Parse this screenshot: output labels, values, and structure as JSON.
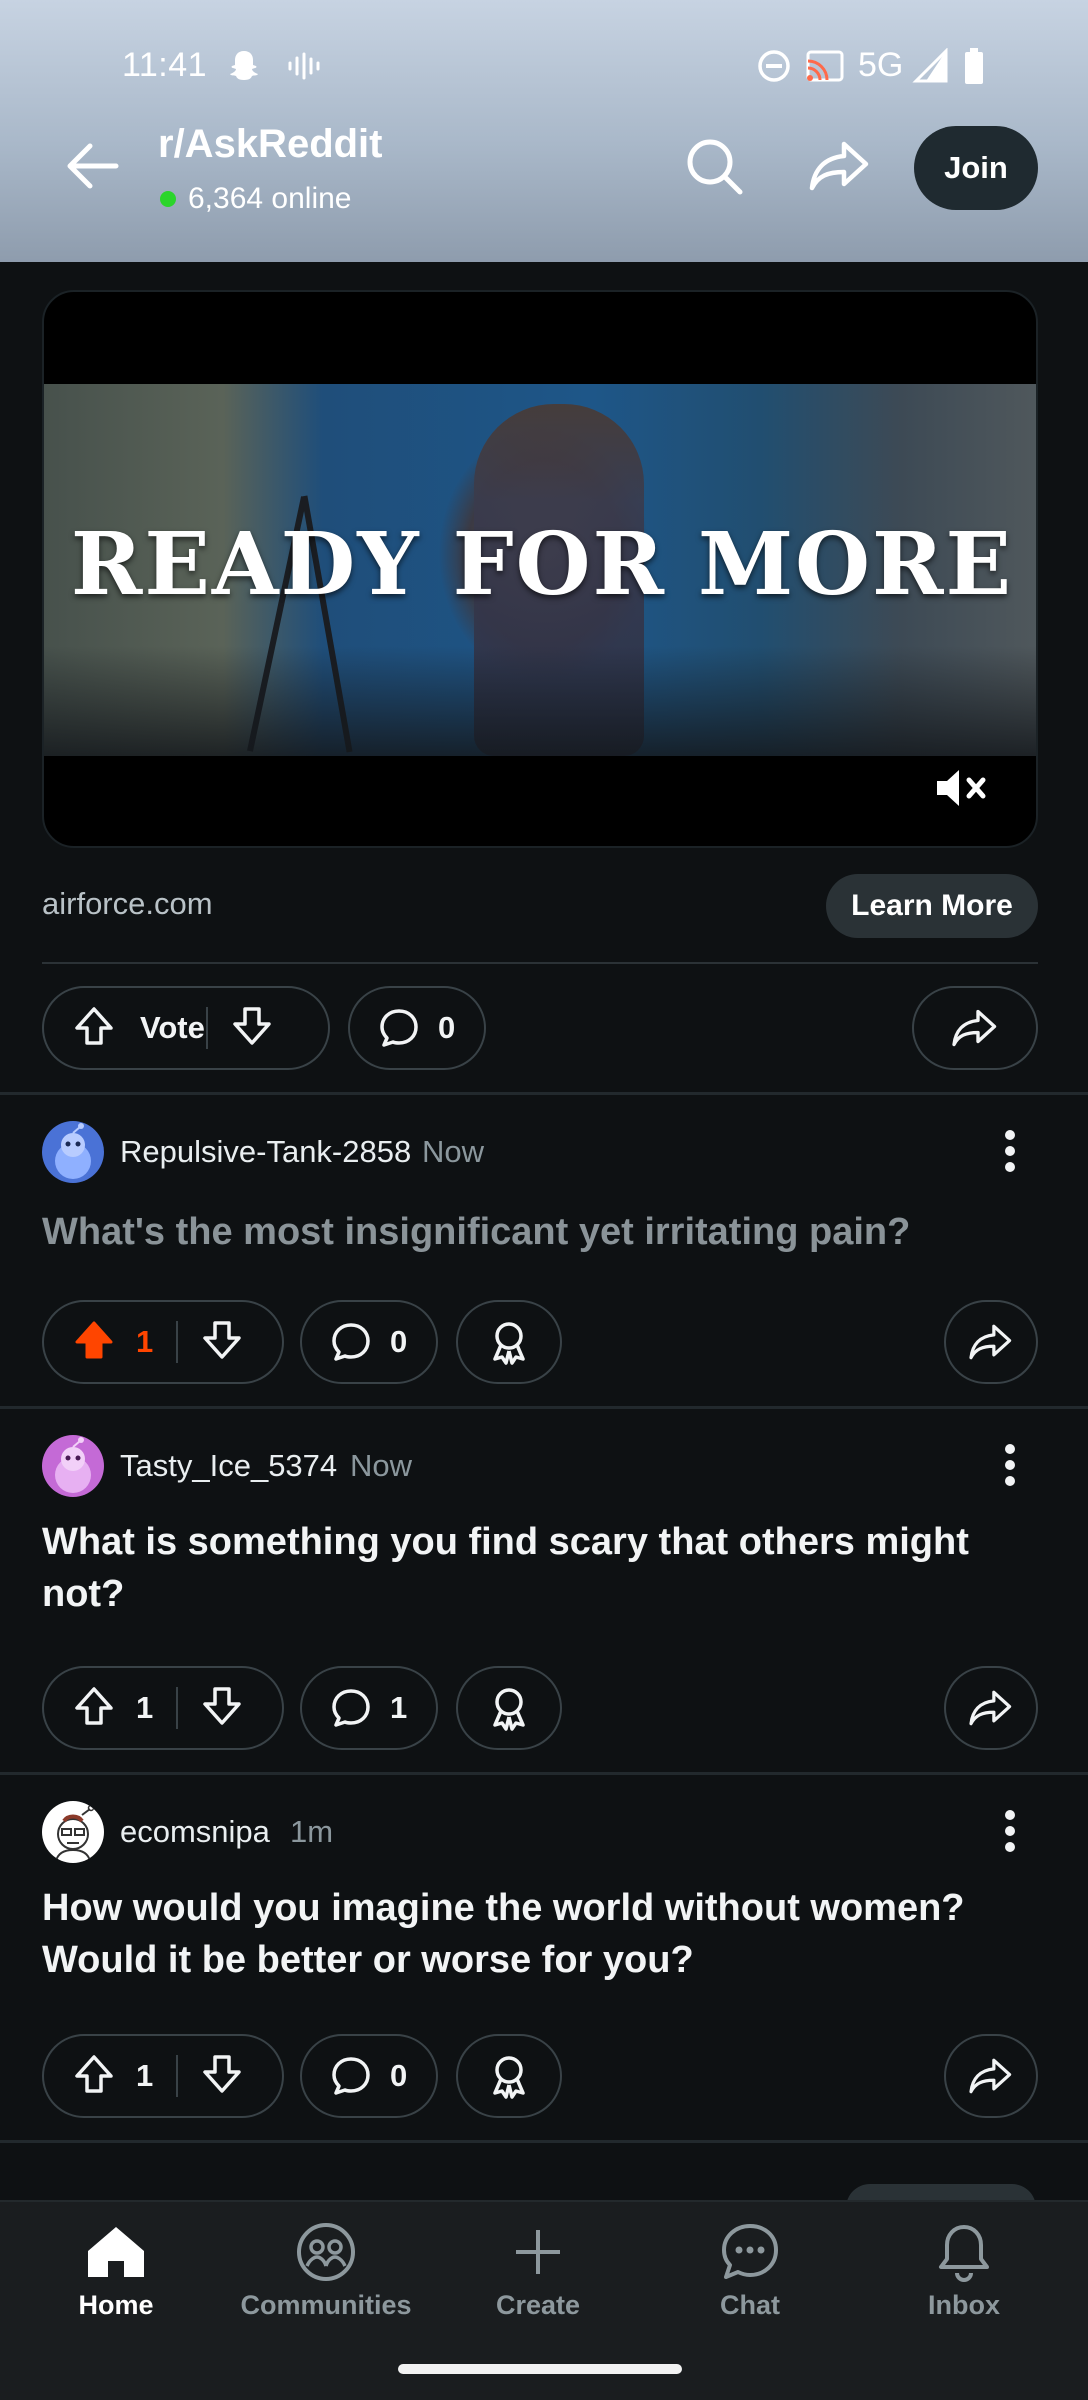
{
  "status_bar": {
    "time": "11:41",
    "network": "5G",
    "icons": [
      "snapchat-icon",
      "voicemail-icon",
      "dnd-icon",
      "cast-icon",
      "signal-icon",
      "battery-icon"
    ]
  },
  "header": {
    "subreddit": "r/AskReddit",
    "online": "6,364 online",
    "join_label": "Join"
  },
  "ad": {
    "headline": "READY FOR MORE",
    "domain": "airforce.com",
    "cta": "Learn More",
    "vote_label": "Vote",
    "comments": "0"
  },
  "posts": [
    {
      "author": "Repulsive-Tank-2858",
      "time": "Now",
      "title": "What's the most insignificant yet irritating pain?",
      "votes": "1",
      "comments": "0",
      "upvoted": true,
      "read": true,
      "avatar_color": "#4a72d6"
    },
    {
      "author": "Tasty_Ice_5374",
      "time": "Now",
      "title": "What is something you find scary that others might not?",
      "votes": "1",
      "comments": "1",
      "upvoted": false,
      "read": false,
      "avatar_color": "#c46ad6"
    },
    {
      "author": "ecomsnipa",
      "time": "1m",
      "title": "How would you imagine the world without women? Would it be better or worse for you?",
      "votes": "1",
      "comments": "0",
      "upvoted": false,
      "read": false,
      "avatar_color": "#ffffff"
    }
  ],
  "bottom_nav": [
    {
      "label": "Home",
      "icon": "home-icon",
      "active": true
    },
    {
      "label": "Communities",
      "icon": "communities-icon",
      "active": false
    },
    {
      "label": "Create",
      "icon": "plus-icon",
      "active": false
    },
    {
      "label": "Chat",
      "icon": "chat-icon",
      "active": false
    },
    {
      "label": "Inbox",
      "icon": "bell-icon",
      "active": false
    }
  ],
  "colors": {
    "background": "#0e1113",
    "upvote_active": "#ff4500",
    "online_dot": "#2bd52b",
    "join_button": "#1f2a30"
  }
}
